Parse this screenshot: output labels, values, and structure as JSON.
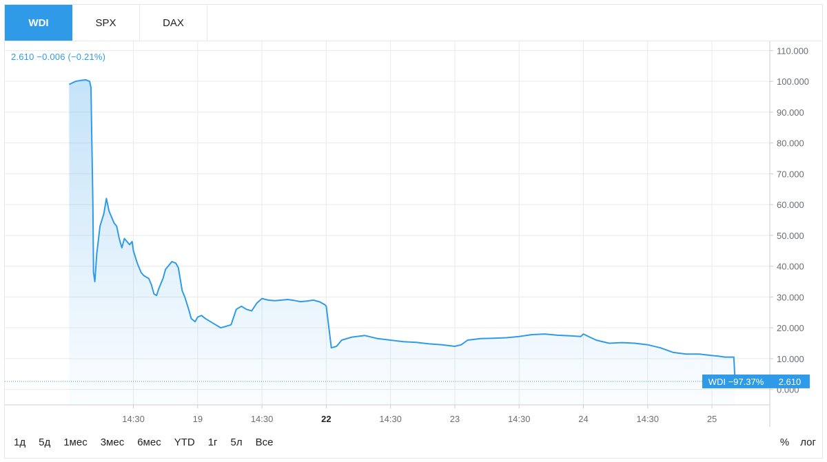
{
  "tabs": [
    {
      "label": "WDI",
      "active": true
    },
    {
      "label": "SPX",
      "active": false
    },
    {
      "label": "DAX",
      "active": false
    }
  ],
  "legend": {
    "text": "2.610 −0.006 (−0.21%)"
  },
  "price_label": {
    "name_pct": "WDI −97.37%",
    "value": "2.610"
  },
  "ranges": [
    "1д",
    "5д",
    "1мес",
    "3мес",
    "6мес",
    "YTD",
    "1г",
    "5л",
    "Все"
  ],
  "options": [
    "%",
    "лог"
  ],
  "colors": {
    "accent": "#2f9be8",
    "grid": "#e8eaed",
    "axis_text": "#6a6d78"
  },
  "chart_data": {
    "type": "area",
    "title": "",
    "xlabel": "",
    "ylabel": "",
    "ylim": [
      -5,
      113
    ],
    "grid": true,
    "y_ticks": [
      0,
      10,
      20,
      30,
      40,
      50,
      60,
      70,
      80,
      90,
      100,
      110
    ],
    "y_tick_labels": [
      "0.000",
      "10.000",
      "20.000",
      "30.000",
      "40.000",
      "50.000",
      "60.000",
      "70.000",
      "80.000",
      "90.000",
      "100.000",
      "110.000"
    ],
    "x_ticks": [
      {
        "label": "14:30",
        "bold": false
      },
      {
        "label": "19",
        "bold": false
      },
      {
        "label": "14:30",
        "bold": false
      },
      {
        "label": "22",
        "bold": true
      },
      {
        "label": "14:30",
        "bold": false
      },
      {
        "label": "23",
        "bold": false
      },
      {
        "label": "14:30",
        "bold": false
      },
      {
        "label": "24",
        "bold": false
      },
      {
        "label": "14:30",
        "bold": false
      },
      {
        "label": "25",
        "bold": false
      }
    ],
    "x_range_days": [
      -0.5,
      5.45
    ],
    "x_tick_positions_days": [
      0.5,
      1,
      1.5,
      2,
      2.5,
      3,
      3.5,
      4,
      4.5,
      5
    ],
    "series": [
      {
        "color": "#2f9be8",
        "x": [
          0.0,
          0.05,
          0.09,
          0.13,
          0.16,
          0.17,
          0.185,
          0.19,
          0.2,
          0.215,
          0.24,
          0.27,
          0.29,
          0.31,
          0.33,
          0.35,
          0.37,
          0.39,
          0.41,
          0.43,
          0.45,
          0.47,
          0.49,
          0.5,
          0.53,
          0.56,
          0.58,
          0.6,
          0.62,
          0.64,
          0.66,
          0.68,
          0.7,
          0.73,
          0.75,
          0.78,
          0.8,
          0.83,
          0.85,
          0.88,
          0.9,
          0.93,
          0.95,
          0.98,
          1.0,
          1.03,
          1.06,
          1.1,
          1.14,
          1.18,
          1.22,
          1.26,
          1.3,
          1.34,
          1.38,
          1.42,
          1.46,
          1.5,
          1.55,
          1.6,
          1.65,
          1.7,
          1.75,
          1.8,
          1.85,
          1.9,
          1.95,
          1.99,
          2.0,
          2.04,
          2.08,
          2.12,
          2.2,
          2.3,
          2.4,
          2.5,
          2.6,
          2.7,
          2.8,
          2.9,
          3.0,
          3.05,
          3.1,
          3.2,
          3.3,
          3.4,
          3.5,
          3.6,
          3.7,
          3.8,
          3.9,
          3.98,
          4.0,
          4.05,
          4.1,
          4.2,
          4.3,
          4.4,
          4.5,
          4.6,
          4.7,
          4.8,
          4.9,
          5.0,
          5.05,
          5.1,
          5.17,
          5.18
        ],
        "values": [
          99.0,
          100.0,
          100.3,
          100.5,
          100.0,
          98.0,
          60.0,
          38.0,
          35.0,
          44.0,
          53.0,
          57.0,
          62.0,
          58.0,
          56.0,
          54.0,
          53.0,
          49.0,
          46.0,
          49.0,
          48.0,
          47.0,
          48.0,
          45.0,
          41.0,
          38.0,
          37.0,
          36.5,
          36.0,
          34.0,
          31.0,
          30.5,
          33.0,
          36.0,
          39.0,
          40.5,
          41.5,
          41.0,
          39.5,
          32.0,
          30.0,
          26.0,
          23.0,
          22.0,
          23.5,
          24.0,
          23.0,
          22.0,
          21.0,
          20.0,
          20.5,
          21.0,
          26.0,
          27.0,
          26.0,
          25.5,
          28.0,
          29.5,
          29.0,
          28.8,
          29.0,
          29.2,
          28.9,
          28.5,
          28.7,
          29.0,
          28.4,
          27.5,
          27.0,
          13.5,
          14.0,
          16.0,
          17.0,
          17.5,
          16.5,
          16.0,
          15.5,
          15.3,
          14.8,
          14.5,
          14.0,
          14.5,
          16.0,
          16.5,
          16.6,
          16.8,
          17.2,
          17.8,
          18.0,
          17.6,
          17.4,
          17.2,
          18.0,
          17.0,
          16.0,
          15.0,
          15.2,
          15.0,
          14.5,
          13.5,
          12.0,
          11.5,
          11.5,
          11.0,
          10.8,
          10.5,
          10.5,
          2.61
        ]
      }
    ],
    "last_value": 2.61
  }
}
